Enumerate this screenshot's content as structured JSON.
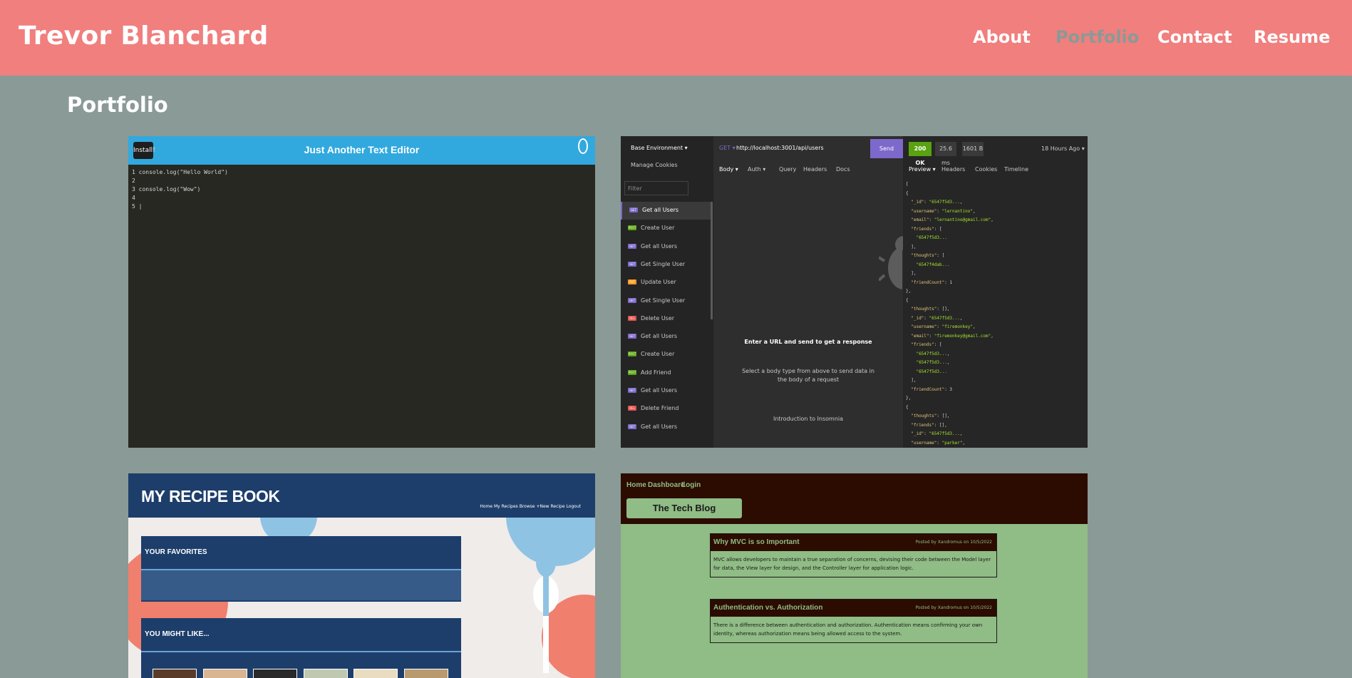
{
  "header": {
    "brand": "Trevor Blanchard",
    "nav": [
      "About",
      "Portfolio",
      "Contact",
      "Resume"
    ],
    "active": "Portfolio"
  },
  "main": {
    "title": "Portfolio"
  },
  "projects": {
    "text_editor": {
      "install_label": "Install!",
      "title": "Just Another Text Editor",
      "code_lines": [
        "1 console.log(\"Hello World\")",
        "2",
        "3 console.log(\"Wow\")",
        "4",
        "5 |"
      ]
    },
    "api_client": {
      "environment": "Base Environment ▾",
      "cookies": "Manage Cookies",
      "filter_placeholder": "Filter",
      "method": "GET ▾",
      "url": "http://localhost:3001/api/users",
      "send": "Send",
      "tabs": [
        "Body ▾",
        "Auth ▾",
        "Query",
        "Headers",
        "Docs"
      ],
      "status": "200 OK",
      "time": "25.6 ms",
      "size": "1601 B",
      "ago": "18 Hours Ago ▾",
      "preview_tabs": [
        "Preview ▾",
        "Headers",
        "Cookies",
        "Timeline"
      ],
      "empty_title": "Enter a URL and send to get a response",
      "empty_sub": "Select a body type from above to send data in the body of a request",
      "intro_link": "Introduction to Insomnia",
      "requests": [
        {
          "method": "GET",
          "name": "Get all Users"
        },
        {
          "method": "POST",
          "name": "Create User"
        },
        {
          "method": "GET",
          "name": "Get all Users"
        },
        {
          "method": "GET",
          "name": "Get Single User"
        },
        {
          "method": "PUT",
          "name": "Update User"
        },
        {
          "method": "GET",
          "name": "Get Single User"
        },
        {
          "method": "DEL",
          "name": "Delete User"
        },
        {
          "method": "GET",
          "name": "Get all Users"
        },
        {
          "method": "POST",
          "name": "Create User"
        },
        {
          "method": "POST",
          "name": "Add Friend"
        },
        {
          "method": "GET",
          "name": "Get all Users"
        },
        {
          "method": "DEL",
          "name": "Delete Friend"
        },
        {
          "method": "GET",
          "name": "Get all Users"
        }
      ],
      "method_colors": {
        "GET": "#7d69cb",
        "POST": "#59a210",
        "PUT": "#ff9a1f",
        "DEL": "#e15251"
      }
    },
    "recipe_book": {
      "brand": "MY RECIPE BOOK",
      "links": "Home   My Recipes   Browse   +New Recipe   Logout",
      "favorites": "YOUR FAVORITES",
      "might_like": "YOU MIGHT LIKE..."
    },
    "tech_blog": {
      "nav": [
        "Home",
        "Dashboard",
        "Login"
      ],
      "title": "The Tech Blog",
      "posts": [
        {
          "title": "Why MVC is so Important",
          "byline": "Posted by Xandromus on 10/5/2022",
          "text": "MVC allows developers to maintain a true separation of concerns, devising their code between the Model layer for data, the View layer for design, and the Controller layer for application logic."
        },
        {
          "title": "Authentication vs. Authorization",
          "byline": "Posted by Xandromus on 10/5/2022",
          "text": "There is a difference between authentication and authorization. Authentication means confirming your own identity, whereas authorization means being allowed access to the system."
        }
      ]
    }
  },
  "colors": {
    "header_bg": "#f07f7e",
    "page_bg": "#8a9a96"
  }
}
